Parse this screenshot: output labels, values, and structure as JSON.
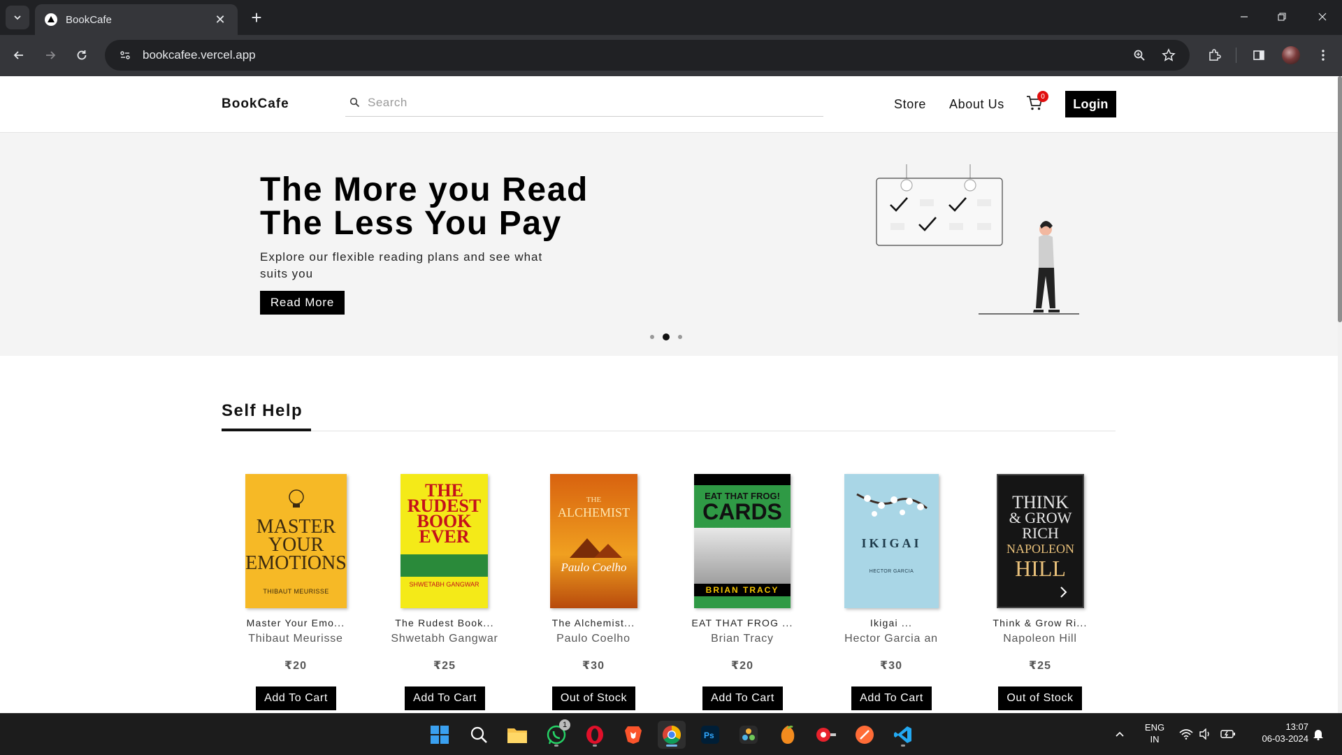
{
  "browser": {
    "tab_title": "BookCafe",
    "url": "bookcafee.vercel.app"
  },
  "header": {
    "brand": "BookCafe",
    "search_placeholder": "Search",
    "nav": [
      "Store",
      "About Us"
    ],
    "cart_count": "0",
    "login_label": "Login"
  },
  "hero": {
    "title_line1": "The More you Read",
    "title_line2": "The Less You Pay",
    "subtitle": "Explore our flexible reading plans and see what suits you",
    "button_label": "Read More",
    "slide_count": 3,
    "active_slide": 2
  },
  "section": {
    "title": "Self Help"
  },
  "books": [
    {
      "title": "Master Your Emo...",
      "author": "Thibaut Meurisse",
      "price": "₹20",
      "button": "Add To Cart",
      "cover_text": [
        "MASTER",
        "YOUR",
        "EMOTIONS"
      ],
      "cover_author": "THIBAUT MEURISSE",
      "cover_color": "#f6b926"
    },
    {
      "title": "The Rudest Book...",
      "author": "Shwetabh Gangwar",
      "price": "₹25",
      "button": "Add To Cart",
      "cover_text": [
        "THE",
        "RUDEST",
        "BOOK",
        "EVER"
      ],
      "cover_author": "SHWETABH GANGWAR",
      "cover_color": "#f4ea18"
    },
    {
      "title": "The Alchemist...",
      "author": "Paulo Coelho",
      "price": "₹30",
      "button": "Out of Stock",
      "cover_text": [
        "THE",
        "ALCHEMIST"
      ],
      "cover_author": "Paulo Coelho",
      "cover_color": "#e07b12"
    },
    {
      "title": "EAT THAT FROG ...",
      "author": "Brian Tracy",
      "price": "₹20",
      "button": "Add To Cart",
      "cover_text": [
        "EAT THAT FROG!",
        "CARDS"
      ],
      "cover_author": "BRIAN TRACY",
      "cover_color": "#3aa547"
    },
    {
      "title": "Ikigai ...",
      "author": "Hector Garcia an",
      "price": "₹30",
      "button": "Add To Cart",
      "cover_text": [
        "IKIGAI"
      ],
      "cover_author": "HECTOR GARCIA",
      "cover_color": "#a9d6e6"
    },
    {
      "title": "Think & Grow Ri...",
      "author": "Napoleon Hill",
      "price": "₹25",
      "button": "Out of Stock",
      "cover_text": [
        "THINK",
        "& GROW",
        "RICH",
        "NAPOLEON",
        "HILL"
      ],
      "cover_author": "",
      "cover_color": "#151515"
    }
  ],
  "taskbar": {
    "apps": [
      "start",
      "search",
      "file-explorer",
      "whatsapp",
      "opera",
      "brave",
      "chrome",
      "photoshop",
      "davinci-resolve",
      "fl-studio",
      "screen-recorder",
      "postman",
      "vscode"
    ],
    "whatsapp_badge": "1",
    "lang_line1": "ENG",
    "lang_line2": "IN",
    "time": "13:07",
    "date": "06-03-2024"
  }
}
